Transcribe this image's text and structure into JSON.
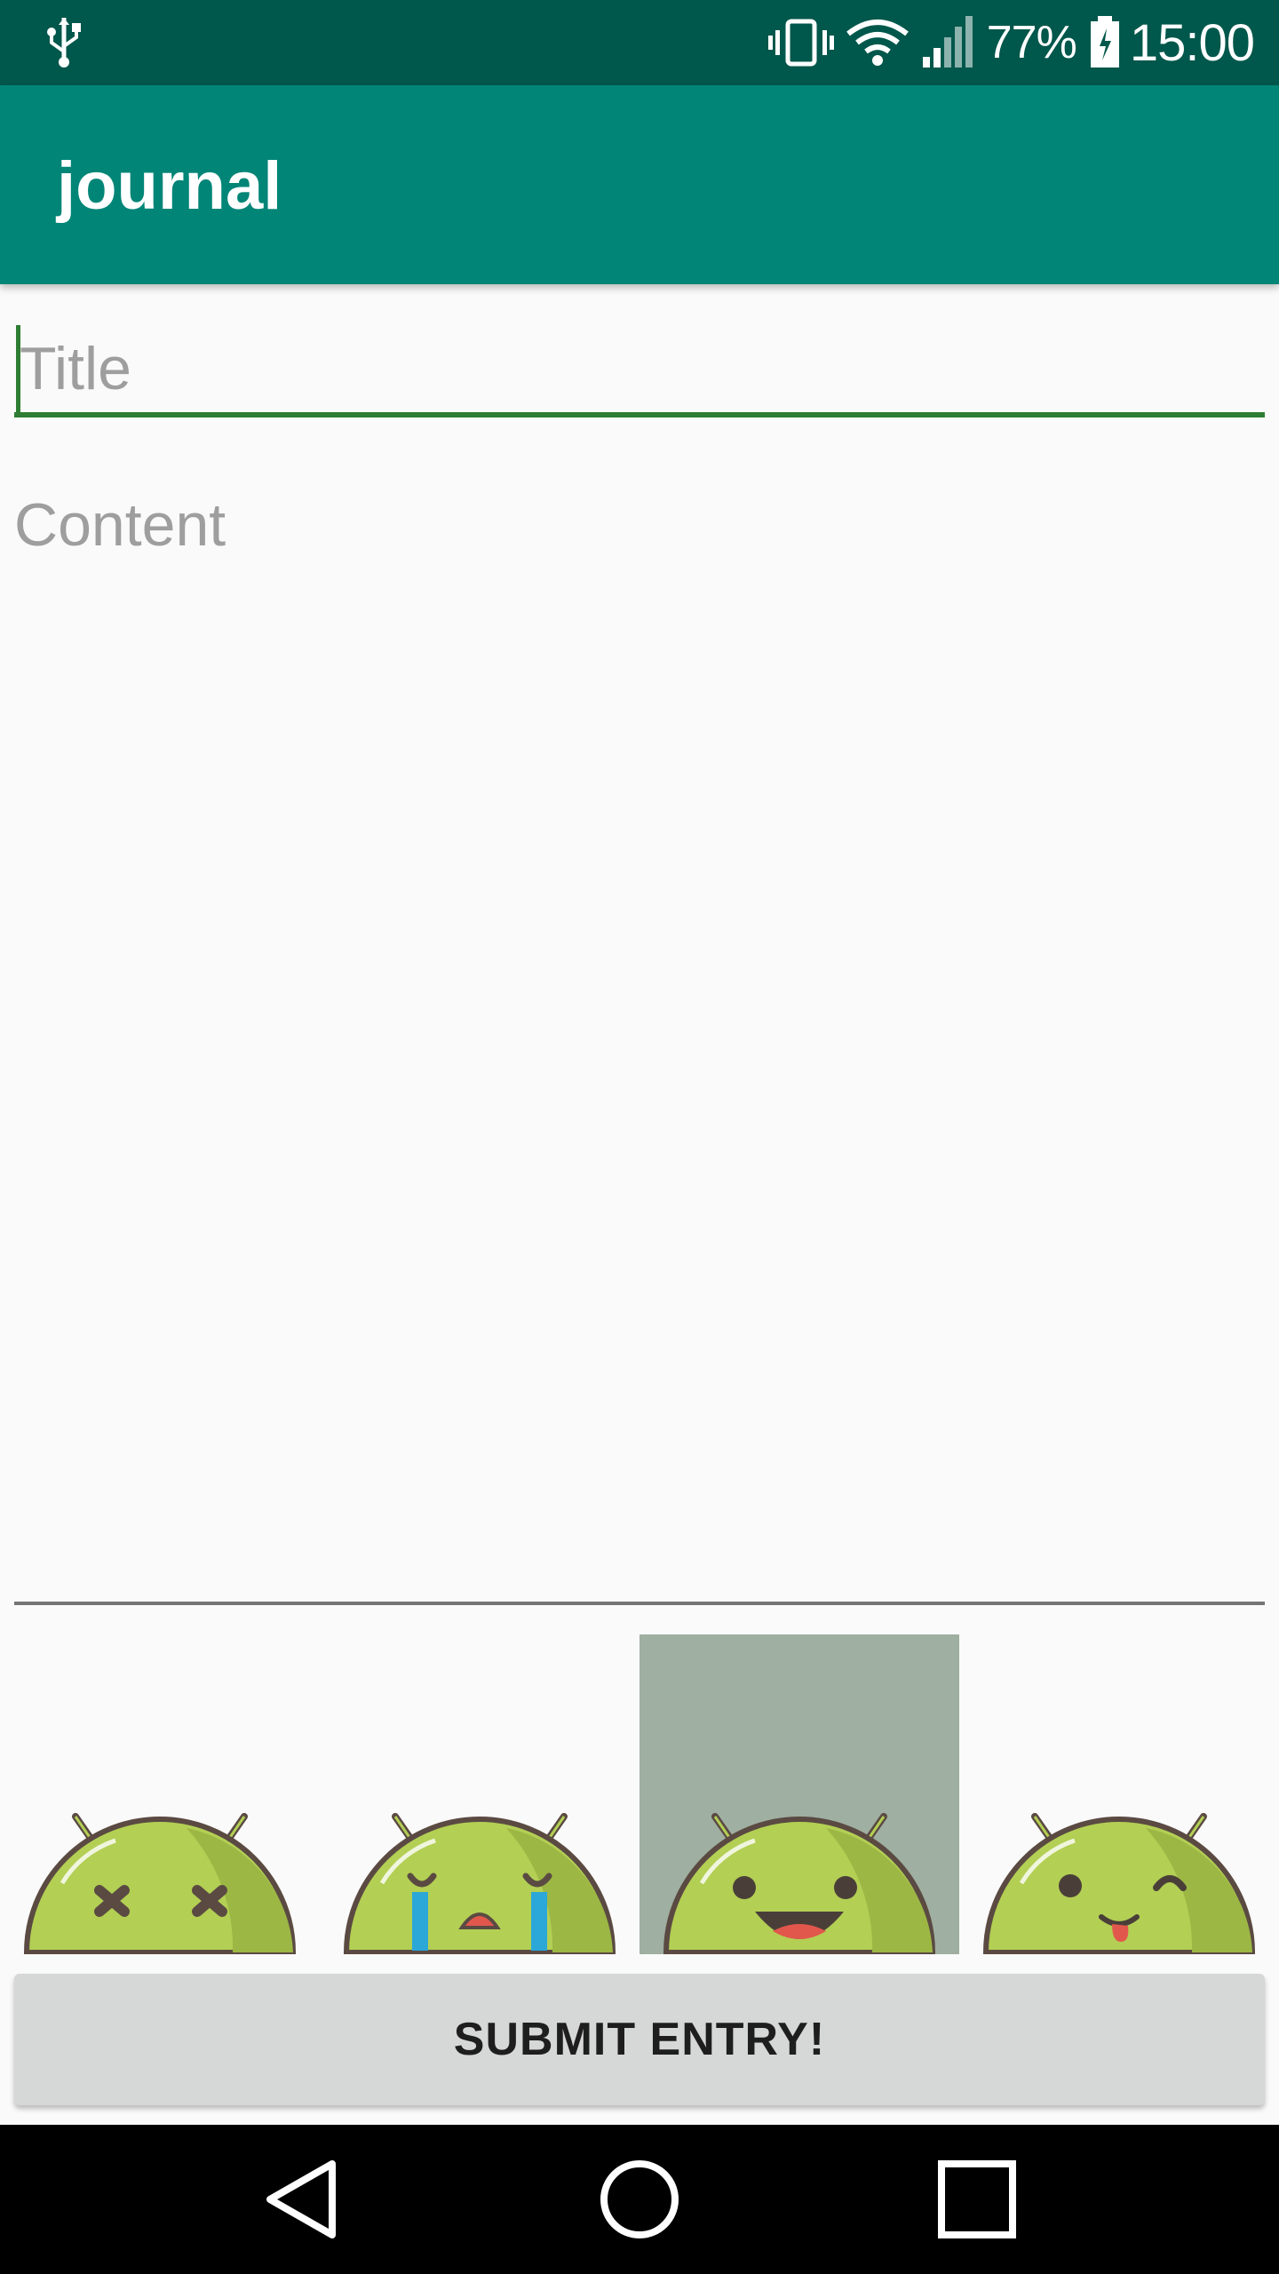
{
  "status_bar": {
    "battery_percent": "77%",
    "time": "15:00",
    "icons": [
      "usb-icon",
      "vibrate-icon",
      "wifi-icon",
      "signal-icon",
      "battery-charging-icon"
    ]
  },
  "app_bar": {
    "title": "journal"
  },
  "form": {
    "title_placeholder": "Title",
    "title_value": "",
    "content_placeholder": "Content",
    "content_value": ""
  },
  "moods": [
    {
      "name": "dead",
      "icon": "android-dead-icon",
      "selected": false
    },
    {
      "name": "crying",
      "icon": "android-crying-icon",
      "selected": false
    },
    {
      "name": "happy",
      "icon": "android-happy-icon",
      "selected": true
    },
    {
      "name": "winking",
      "icon": "android-wink-icon",
      "selected": false
    }
  ],
  "submit_label": "SUBMIT ENTRY!",
  "colors": {
    "status_bar": "#00574b",
    "app_bar": "#008577",
    "accent_underline": "#2e7d32",
    "selected_mood_bg": "#9fafa1",
    "android_green": "#b3cf54",
    "button_bg": "#d6d7d7"
  },
  "nav_bar": {
    "icons": [
      "back-icon",
      "home-icon",
      "recents-icon"
    ]
  }
}
